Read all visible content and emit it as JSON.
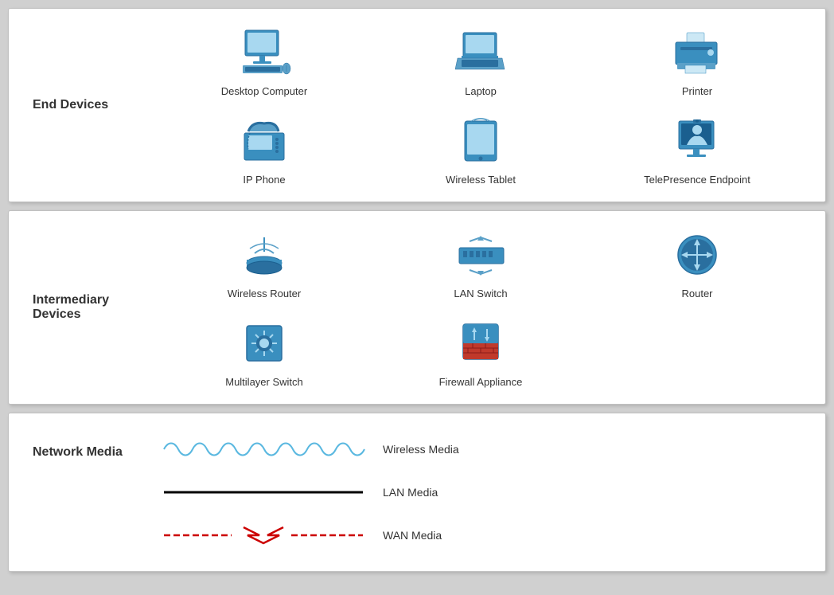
{
  "sections": {
    "end_devices": {
      "label": "End Devices",
      "devices": [
        {
          "id": "desktop",
          "label": "Desktop Computer"
        },
        {
          "id": "laptop",
          "label": "Laptop"
        },
        {
          "id": "printer",
          "label": "Printer"
        },
        {
          "id": "ipphone",
          "label": "IP Phone"
        },
        {
          "id": "tablet",
          "label": "Wireless Tablet"
        },
        {
          "id": "telepresence",
          "label": "TelePresence Endpoint"
        }
      ]
    },
    "intermediary_devices": {
      "label": "Intermediary\nDevices",
      "devices": [
        {
          "id": "wireless-router",
          "label": "Wireless Router"
        },
        {
          "id": "lan-switch",
          "label": "LAN Switch"
        },
        {
          "id": "router",
          "label": "Router"
        },
        {
          "id": "multilayer-switch",
          "label": "Multilayer Switch"
        },
        {
          "id": "firewall",
          "label": "Firewall Appliance"
        },
        {
          "id": "empty",
          "label": ""
        }
      ]
    },
    "network_media": {
      "label": "Network Media",
      "media": [
        {
          "id": "wireless",
          "label": "Wireless Media"
        },
        {
          "id": "lan",
          "label": "LAN Media"
        },
        {
          "id": "wan",
          "label": "WAN Media"
        }
      ]
    }
  }
}
